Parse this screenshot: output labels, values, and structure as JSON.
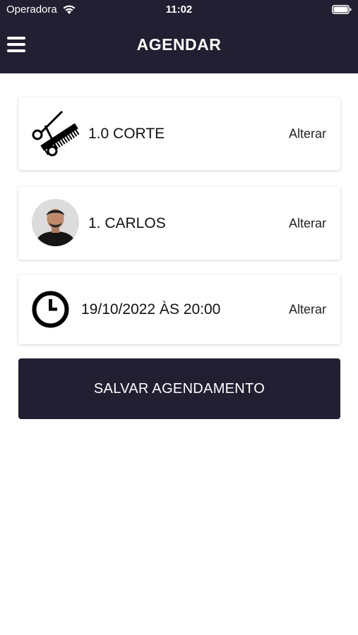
{
  "status_bar": {
    "carrier": "Operadora",
    "time": "11:02"
  },
  "header": {
    "title": "AGENDAR"
  },
  "cards": {
    "service": {
      "label": "1.0 CORTE",
      "action": "Alterar",
      "icon": "scissors-comb-icon"
    },
    "professional": {
      "label": "1. CARLOS",
      "action": "Alterar",
      "icon": "avatar"
    },
    "datetime": {
      "label": "19/10/2022 ÀS 20:00",
      "action": "Alterar",
      "icon": "clock-icon"
    }
  },
  "save_button": {
    "label": "SALVAR AGENDAMENTO"
  },
  "colors": {
    "header_bg": "#211f31",
    "button_bg": "#211f31",
    "background": "#ffffff"
  }
}
